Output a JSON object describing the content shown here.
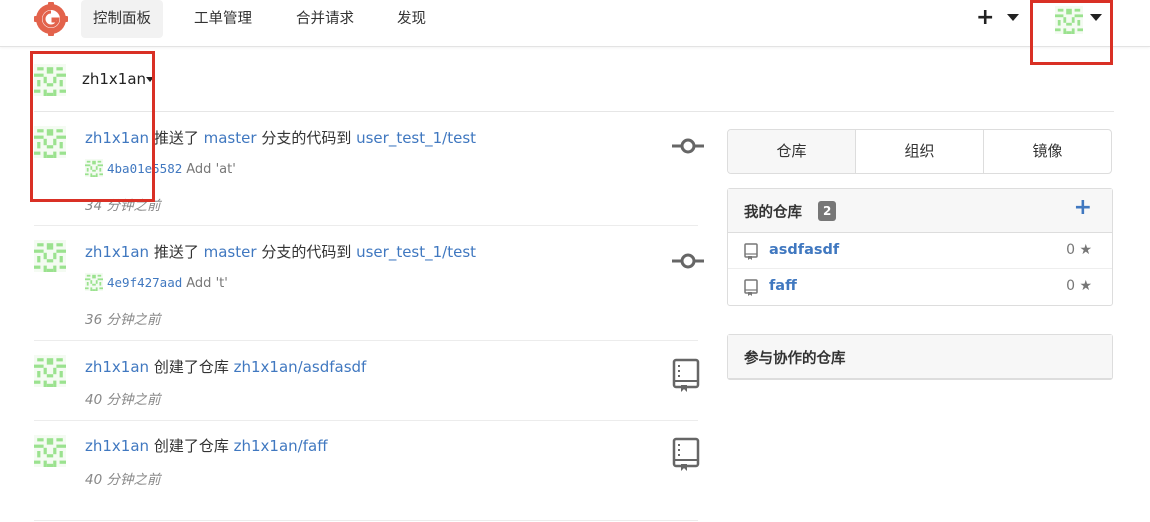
{
  "nav": {
    "items": [
      {
        "label": "控制面板",
        "active": true
      },
      {
        "label": "工单管理",
        "active": false
      },
      {
        "label": "合并请求",
        "active": false
      },
      {
        "label": "发现",
        "active": false
      }
    ],
    "create_label": "+"
  },
  "context": {
    "username": "zh1x1an"
  },
  "feed": [
    {
      "user": "zh1x1an",
      "action": "推送了",
      "branch": "master",
      "middle": "分支的代码到",
      "repo": "user_test_1/test",
      "sha": "4ba01e5582",
      "message": "Add 'at'",
      "time": "34 分钟之前",
      "icon": "commit-icon"
    },
    {
      "user": "zh1x1an",
      "action": "推送了",
      "branch": "master",
      "middle": "分支的代码到",
      "repo": "user_test_1/test",
      "sha": "4e9f427aad",
      "message": "Add 't'",
      "time": "36 分钟之前",
      "icon": "commit-icon"
    },
    {
      "user": "zh1x1an",
      "action": "创建了仓库",
      "repo": "zh1x1an/asdfasdf",
      "time": "40 分钟之前",
      "icon": "repo-book-icon"
    },
    {
      "user": "zh1x1an",
      "action": "创建了仓库",
      "repo": "zh1x1an/faff",
      "time": "40 分钟之前",
      "icon": "repo-book-icon"
    }
  ],
  "tabs": [
    {
      "label": "仓库",
      "active": true
    },
    {
      "label": "组织",
      "active": false
    },
    {
      "label": "镜像",
      "active": false
    }
  ],
  "my_repos": {
    "title": "我的仓库",
    "count": "2",
    "add_label": "+",
    "items": [
      {
        "name": "asdfasdf",
        "stars": "0"
      },
      {
        "name": "faff",
        "stars": "0"
      }
    ]
  },
  "collab_repos": {
    "title": "参与协作的仓库"
  },
  "colors": {
    "link": "#4078c0",
    "highlight": "#d93025",
    "identicon": "#9be28f"
  }
}
